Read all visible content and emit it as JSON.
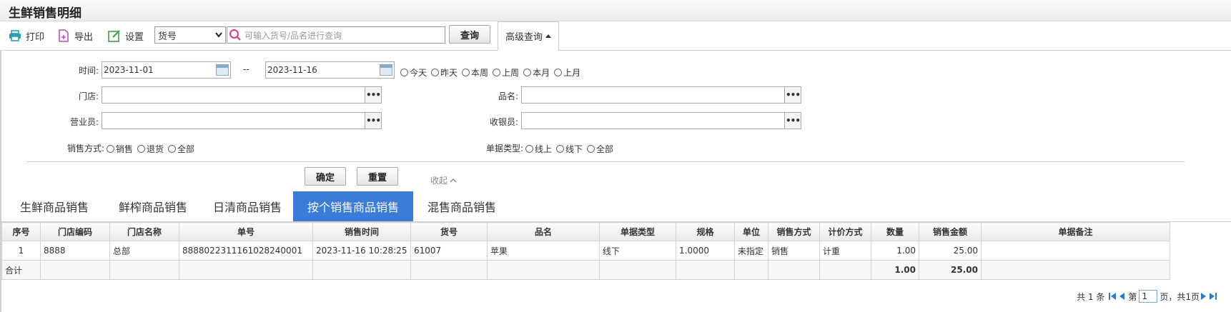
{
  "app": {
    "title": "生鲜销售明细"
  },
  "toolbar": {
    "print_label": "打印",
    "export_label": "导出",
    "settings_label": "设置",
    "field_select_value": "货号",
    "search_placeholder": "可输入货号/品名进行查询",
    "query_label": "查询",
    "advanced_label": "高级查询"
  },
  "filters": {
    "time_label": "时间:",
    "date_from": "2023-11-01",
    "date_sep": "--",
    "date_to": "2023-11-16",
    "quick_ranges": [
      "今天",
      "昨天",
      "本周",
      "上周",
      "本月",
      "上月"
    ],
    "store_label": "门店:",
    "product_label": "品名:",
    "salesperson_label": "营业员:",
    "cashier_label": "收银员:",
    "sale_mode_label": "销售方式:",
    "sale_modes": [
      "销售",
      "退货",
      "全部"
    ],
    "doc_type_label": "单据类型:",
    "doc_types": [
      "线上",
      "线下",
      "全部"
    ],
    "picker_glyph": "•••",
    "confirm_label": "确定",
    "reset_label": "重置",
    "collapse_label": "收起"
  },
  "tabs": [
    {
      "label": "生鲜商品销售",
      "active": false
    },
    {
      "label": "鲜榨商品销售",
      "active": false
    },
    {
      "label": "日清商品销售",
      "active": false
    },
    {
      "label": "按个销售商品销售",
      "active": true
    },
    {
      "label": "混售商品销售",
      "active": false
    }
  ],
  "table": {
    "headers": [
      "序号",
      "门店编码",
      "门店名称",
      "单号",
      "销售时间",
      "货号",
      "品名",
      "单据类型",
      "规格",
      "单位",
      "销售方式",
      "计价方式",
      "数量",
      "销售金额",
      "单据备注"
    ],
    "rows": [
      [
        "1",
        "8888",
        "总部",
        "8888022311161028240001",
        "2023-11-16 10:28:25",
        "61007",
        "苹果",
        "线下",
        "1.0000",
        "未指定",
        "销售",
        "计重",
        "1.00",
        "25.00",
        ""
      ]
    ],
    "summary": {
      "label": "合计",
      "qty": "1.00",
      "amount": "25.00"
    }
  },
  "pager": {
    "total_text": "共 1 条",
    "page_prefix": "第",
    "page_value": "1",
    "page_suffix": "页，共1页"
  },
  "colors": {
    "accent": "#3b7cd8",
    "print_icon": "#2a9fb5",
    "export_icon": "#b84fc9",
    "settings_icon": "#3aa04a",
    "search_icon": "#d63a8a"
  }
}
